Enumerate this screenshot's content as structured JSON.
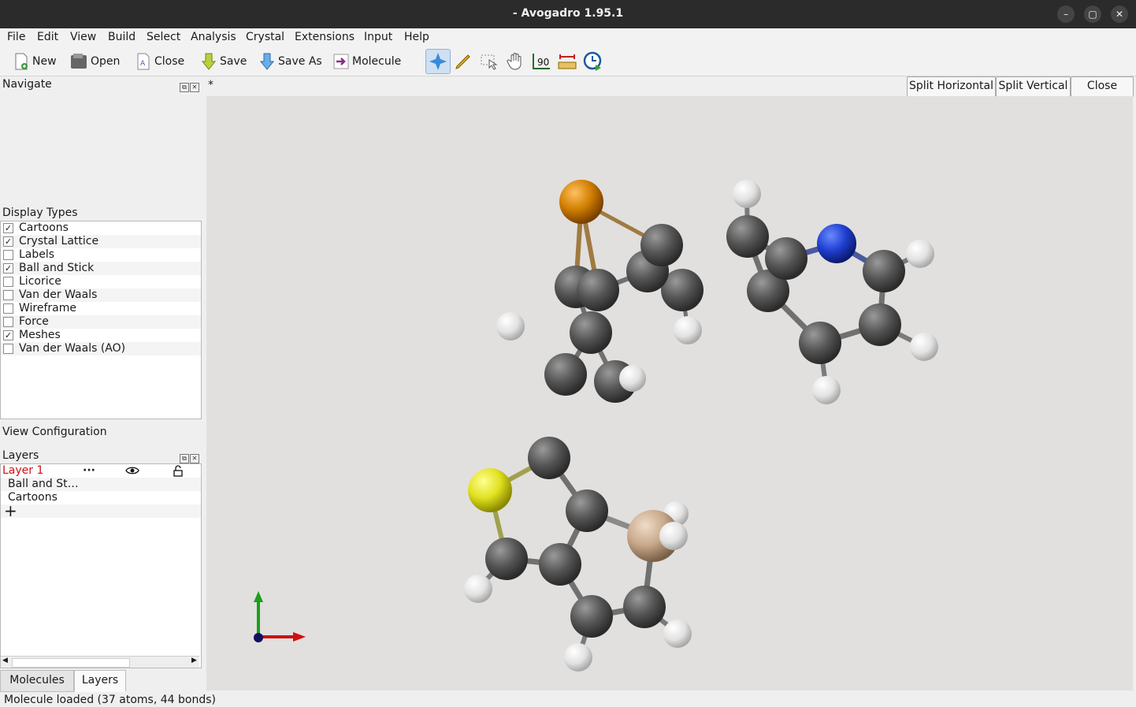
{
  "window": {
    "title": "- Avogadro 1.95.1"
  },
  "menu": [
    "File",
    "Edit",
    "View",
    "Build",
    "Select",
    "Analysis",
    "Crystal",
    "Extensions",
    "Input",
    "Help"
  ],
  "toolbar": {
    "new": "New",
    "open": "Open",
    "close": "Close",
    "save": "Save",
    "save_as": "Save As",
    "molecule": "Molecule",
    "tools": [
      "navigate-tool-icon",
      "draw-tool-icon",
      "select-tool-icon",
      "manipulate-tool-icon",
      "bond-centric-tool-icon",
      "measure-tool-icon",
      "playback-tool-icon"
    ]
  },
  "navigate": {
    "title": "Navigate"
  },
  "display_types": {
    "title": "Display Types",
    "items": [
      {
        "label": "Cartoons",
        "checked": true,
        "mark": "✓"
      },
      {
        "label": "Crystal Lattice",
        "checked": true,
        "mark": "✓"
      },
      {
        "label": "Labels",
        "checked": false,
        "mark": ""
      },
      {
        "label": "Ball and Stick",
        "checked": true,
        "mark": "✓"
      },
      {
        "label": "Licorice",
        "checked": false,
        "mark": ""
      },
      {
        "label": "Van der Waals",
        "checked": false,
        "mark": ""
      },
      {
        "label": "Wireframe",
        "checked": false,
        "mark": ""
      },
      {
        "label": "Force",
        "checked": false,
        "mark": ""
      },
      {
        "label": "Meshes",
        "checked": true,
        "mark": "✓"
      },
      {
        "label": "Van der Waals (AO)",
        "checked": false,
        "mark": ""
      }
    ]
  },
  "view_config": {
    "title": "View Configuration"
  },
  "layers": {
    "title": "Layers",
    "layer_name": "Layer 1",
    "more": "···",
    "rows": [
      "Ball and St…",
      "Cartoons"
    ],
    "add": "+"
  },
  "tabs": {
    "molecules": "Molecules",
    "layers": "Layers"
  },
  "viewport": {
    "tab_marker": "*",
    "split_horizontal": "Split Horizontal",
    "split_vertical": "Split Vertical",
    "close": "Close",
    "atom_colors": {
      "carbon": "#5a5a5a",
      "hydrogen": "#e6e6e6",
      "nitrogen": "#1f3fd0",
      "sulfur": "#e0e020",
      "phosphorus": "#e08a00",
      "silicon": "#c8a88a"
    }
  },
  "status": {
    "text": "Molecule loaded (37 atoms, 44 bonds)"
  }
}
